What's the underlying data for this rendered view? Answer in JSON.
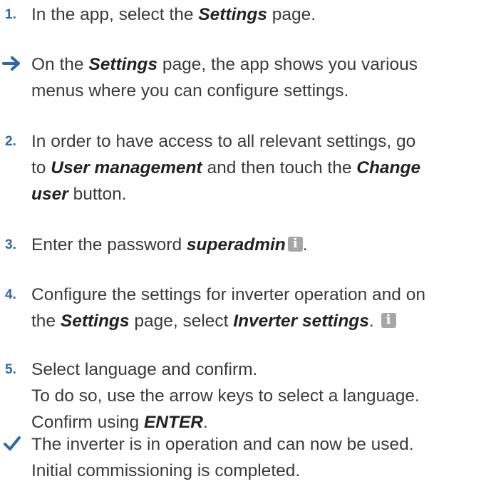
{
  "steps": [
    {
      "marker": "1.",
      "parts": [
        "In the app, select the ",
        "Settings",
        " page."
      ]
    },
    {
      "marker": "arrow",
      "line1": [
        "On the ",
        "Settings",
        " page, the app shows you various"
      ],
      "line2": "menus where you can configure settings."
    },
    {
      "marker": "2.",
      "line1": "In order to have access to all relevant settings, go",
      "line2": [
        "to ",
        "User management",
        " and then touch the ",
        "Change"
      ],
      "line3": [
        "user",
        " button."
      ]
    },
    {
      "marker": "3.",
      "parts": [
        "Enter the password ",
        "superadmin",
        "."
      ],
      "icon": "info-icon"
    },
    {
      "marker": "4.",
      "line1": "Configure the settings for inverter operation and on",
      "line2": [
        "the ",
        "Settings",
        " page, select ",
        "Inverter settings",
        "."
      ],
      "icon": "info-icon"
    },
    {
      "marker": "5.",
      "line1": "Select language and confirm.",
      "line2": "To do so, use the arrow keys to select a language.",
      "line3": [
        "Confirm using ",
        "ENTER",
        "."
      ]
    },
    {
      "marker": "check",
      "line1": "The inverter is in operation and can now be used.",
      "line2": "Initial commissioning is completed."
    }
  ],
  "icon_glyph": "i",
  "colors": {
    "accent": "#2f67a8",
    "text": "#3a3a3a",
    "info_icon_bg": "#a6a6a6"
  }
}
